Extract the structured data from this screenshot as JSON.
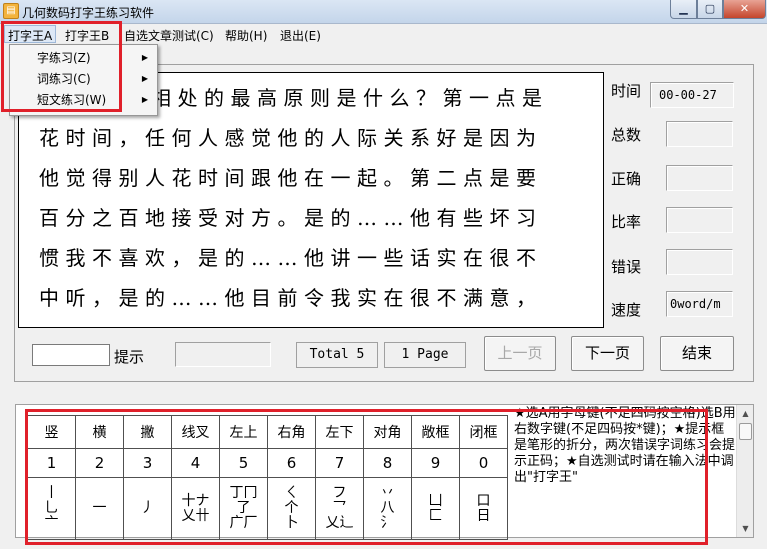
{
  "window": {
    "title": "几何数码打字王练习软件",
    "app_icon": "ABC-icon",
    "controls": [
      "minimize",
      "maximize",
      "close"
    ]
  },
  "menubar": [
    {
      "label": "打字王A",
      "open": true
    },
    {
      "label": "打字王B"
    },
    {
      "label": "自选文章测试(C)"
    },
    {
      "label": "帮助(H)"
    },
    {
      "label": "退出(E)"
    }
  ],
  "dropdown": {
    "items": [
      {
        "label": "字练习(Z)",
        "has_submenu": true
      },
      {
        "label": "词练习(C)",
        "has_submenu": true
      },
      {
        "label": "短文练习(W)",
        "has_submenu": true
      }
    ]
  },
  "practice_text": {
    "lines": [
      "相处的最高原则是什么？第一点是",
      "花时间，任何人感觉他的人际关系好是因为",
      "他觉得别人花时间跟他在一起。第二点是要",
      "百分之百地接受对方。是的……他有些坏习",
      "惯我不喜欢，是的……他讲一些话实在很不",
      "中听，是的……他目前令我实在很不满意，"
    ]
  },
  "stats": {
    "time_label": "时间",
    "time_value": "00-00-27",
    "total_label": "总数",
    "total_value": "",
    "correct_label": "正确",
    "correct_value": "",
    "ratio_label": "比率",
    "ratio_value": "",
    "error_label": "错误",
    "error_value": "",
    "speed_label": "速度",
    "speed_value": "0word/m"
  },
  "controls": {
    "input_value": "",
    "hint_label": "提示",
    "hint_value": "",
    "total_info": "Total 5",
    "page_info": "1 Page",
    "prev_label": "上一页",
    "next_label": "下一页",
    "end_label": "结束"
  },
  "stroke_table": {
    "names": [
      "竖",
      "横",
      "撇",
      "线叉",
      "左上",
      "右角",
      "左下",
      "对角",
      "敞框",
      "闭框"
    ],
    "numbers": [
      "1",
      "2",
      "3",
      "4",
      "5",
      "6",
      "7",
      "8",
      "9",
      "0"
    ],
    "glyphs": [
      "丨\n乚\n亠",
      "一",
      "丿",
      "十ナ\n乂卄",
      "丁冂\n了\n广厂",
      "ㄑ\n个\n卜",
      "フ\n乛\n乂辶",
      "丷\n八\n氵",
      "凵\n匚",
      "口\n日"
    ]
  },
  "help_text": "★选A用字母键(不足四码按空格)选B用右数字键(不足四码按*键)；★提示框是笔形的折分，两次错误字词练习会提示正码；★自选测试时请在输入法中调出\"打字王\"",
  "highlight_color": "#e0202a"
}
